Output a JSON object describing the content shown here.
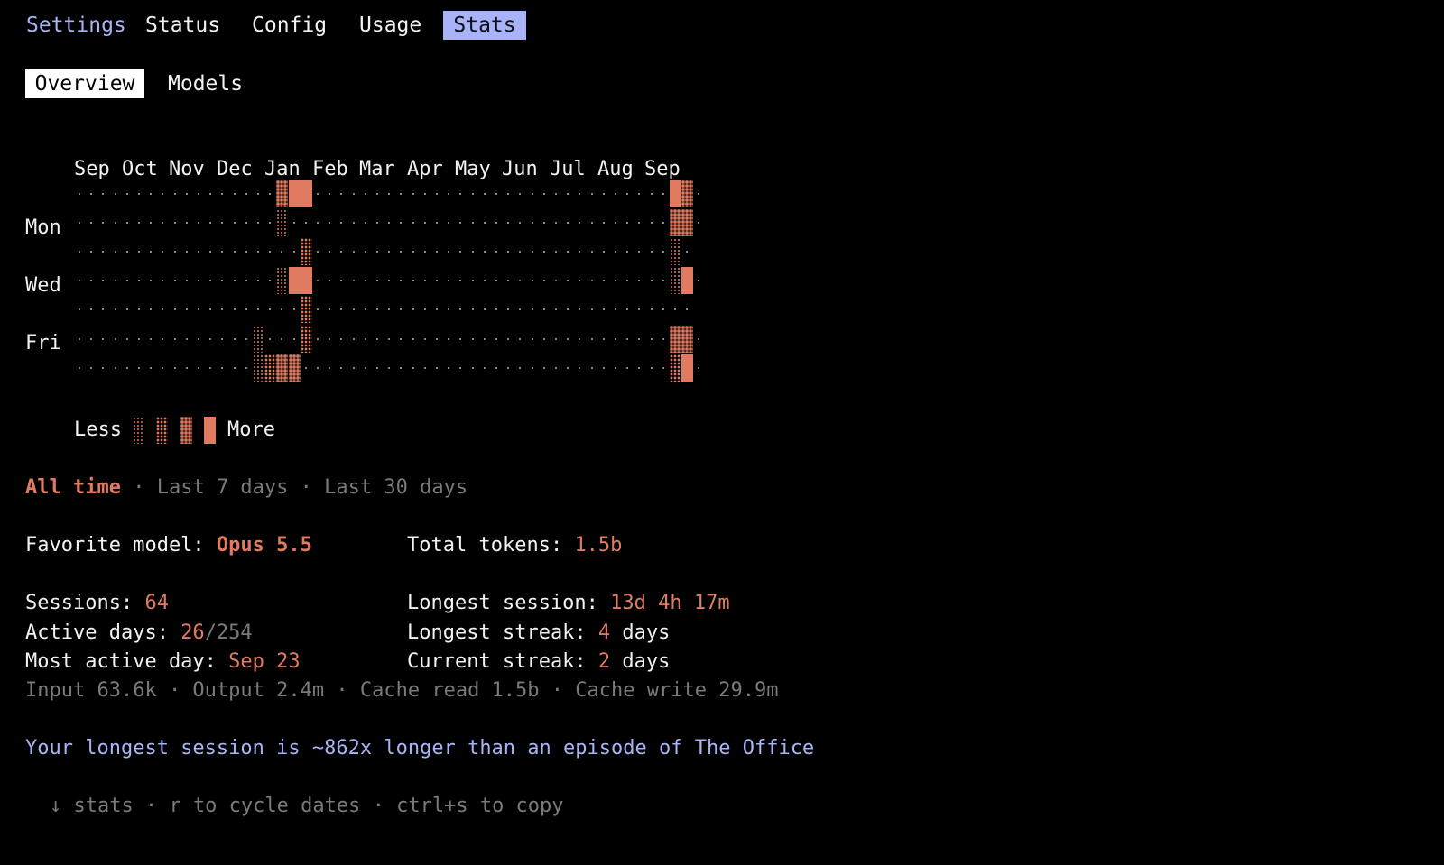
{
  "tabs": {
    "settings": "Settings",
    "status": "Status",
    "config": "Config",
    "usage": "Usage",
    "stats": "Stats"
  },
  "subtabs": {
    "overview": "Overview",
    "models": "Models"
  },
  "heatmap": {
    "months": [
      "Sep",
      "Oct",
      "Nov",
      "Dec",
      "Jan",
      "Feb",
      "Mar",
      "Apr",
      "May",
      "Jun",
      "Jul",
      "Aug",
      "Sep"
    ],
    "day_labels": [
      "Mon",
      "Wed",
      "Fri"
    ],
    "weeks": 53,
    "active_cells": [
      {
        "day": 0,
        "week": 17,
        "level": 3
      },
      {
        "day": 0,
        "week": 18,
        "level": 4
      },
      {
        "day": 0,
        "week": 19,
        "level": 4
      },
      {
        "day": 0,
        "week": 50,
        "level": 4
      },
      {
        "day": 0,
        "week": 51,
        "level": 3
      },
      {
        "day": 1,
        "week": 17,
        "level": 1
      },
      {
        "day": 1,
        "week": 50,
        "level": 3
      },
      {
        "day": 1,
        "week": 51,
        "level": 3
      },
      {
        "day": 2,
        "week": 19,
        "level": 2
      },
      {
        "day": 2,
        "week": 50,
        "level": 1
      },
      {
        "day": 3,
        "week": 17,
        "level": 1
      },
      {
        "day": 3,
        "week": 18,
        "level": 4
      },
      {
        "day": 3,
        "week": 19,
        "level": 4
      },
      {
        "day": 3,
        "week": 50,
        "level": 1
      },
      {
        "day": 3,
        "week": 51,
        "level": 4
      },
      {
        "day": 4,
        "week": 19,
        "level": 2
      },
      {
        "day": 5,
        "week": 15,
        "level": 1
      },
      {
        "day": 5,
        "week": 19,
        "level": 2
      },
      {
        "day": 5,
        "week": 50,
        "level": 3
      },
      {
        "day": 5,
        "week": 51,
        "level": 3
      },
      {
        "day": 6,
        "week": 15,
        "level": 1
      },
      {
        "day": 6,
        "week": 16,
        "level": 2
      },
      {
        "day": 6,
        "week": 17,
        "level": 3
      },
      {
        "day": 6,
        "week": 18,
        "level": 3
      },
      {
        "day": 6,
        "week": 50,
        "level": 2
      },
      {
        "day": 6,
        "week": 51,
        "level": 4
      }
    ],
    "legend_less": "Less",
    "legend_more": "More"
  },
  "ranges": {
    "all": "All time",
    "sep1": "·",
    "last7": "Last 7 days",
    "sep2": "·",
    "last30": "Last 30 days"
  },
  "stats": {
    "favorite_label": "Favorite model: ",
    "favorite_value": "Opus 5.5",
    "total_tokens_label": "Total tokens: ",
    "total_tokens_value": "1.5b",
    "sessions_label": "Sessions: ",
    "sessions_value": "64",
    "longest_session_label": "Longest session: ",
    "longest_session_value": "13d 4h 17m",
    "active_days_label": "Active days: ",
    "active_days_value": "26",
    "active_days_total": "/254",
    "longest_streak_label": "Longest streak: ",
    "longest_streak_value": "4",
    "longest_streak_unit": " days",
    "most_active_label": "Most active day: ",
    "most_active_value": "Sep 23",
    "current_streak_label": "Current streak: ",
    "current_streak_value": "2",
    "current_streak_unit": " days",
    "token_breakdown": "Input 63.6k · Output 2.4m · Cache read 1.5b · Cache write 29.9m"
  },
  "fun_fact": "Your longest session is ~862x longer than an episode of The Office",
  "footer": "↓ stats · r to cycle dates · ctrl+s to copy",
  "colors": {
    "accent": "#e07b62",
    "lavender": "#a8b4f7",
    "background": "#000000"
  }
}
